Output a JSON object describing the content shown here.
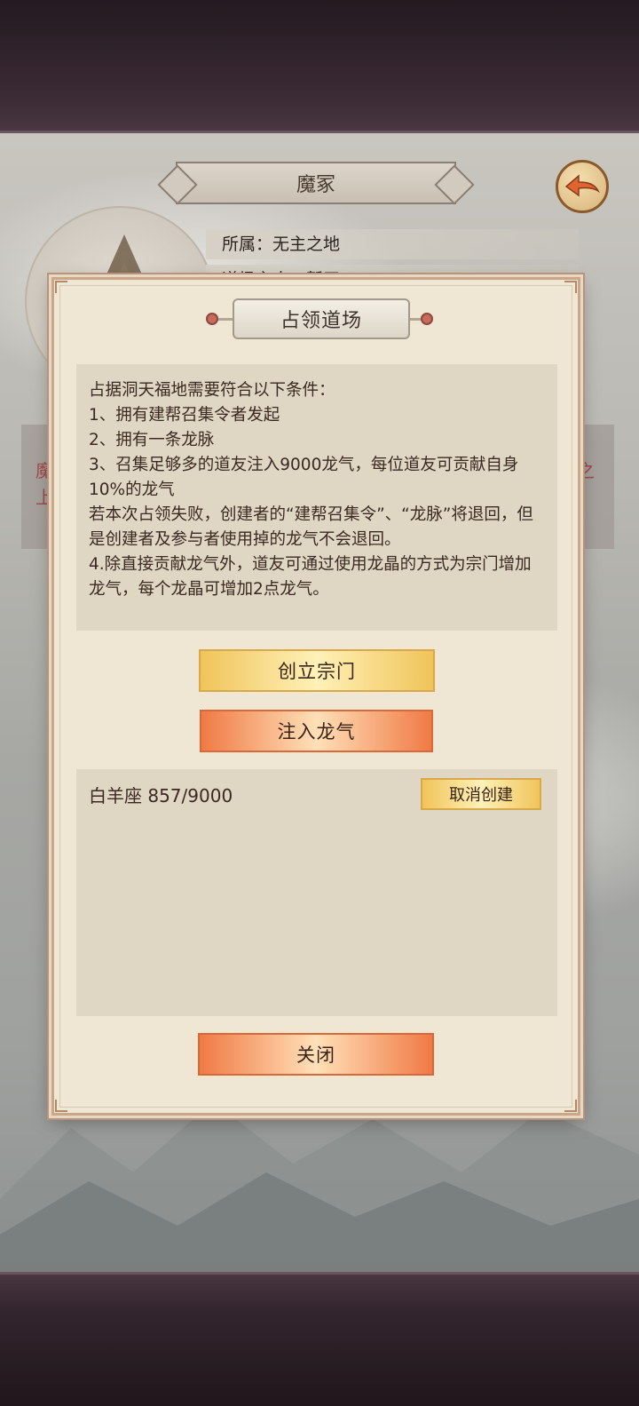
{
  "location": {
    "name": "魔冢",
    "affiliation": "所属：无主之地",
    "owner_partial": "道场主人：暂无"
  },
  "background_text": {
    "left_char_1": "魔",
    "left_char_2": "上",
    "right_char": "之"
  },
  "dialog": {
    "title": "占领道场",
    "rules": [
      "占据洞天福地需要符合以下条件：",
      "1、拥有建帮召集令者发起",
      "2、拥有一条龙脉",
      "3、召集足够多的道友注入9000龙气，每位道友可贡献自身10%的龙气",
      "若本次占领失败，创建者的“建帮召集令”、“龙脉”将退回，但是创建者及参与者使用掉的龙气不会退回。",
      "4.除直接贡献龙气外，道友可通过使用龙晶的方式为宗门增加龙气，每个龙晶可增加2点龙气。"
    ],
    "create_button": "创立宗门",
    "inject_button": "注入龙气",
    "progress_entry": {
      "name": "白羊座 857/9000",
      "cancel_button": "取消创建"
    },
    "close_button": "关闭"
  },
  "colors": {
    "dialog_bg": "#efe6d3",
    "gold_button": "#f0c45a",
    "orange_button": "#f07a45",
    "text_dark": "#3a2a22"
  },
  "icons": {
    "back": "back-arrow-icon"
  }
}
